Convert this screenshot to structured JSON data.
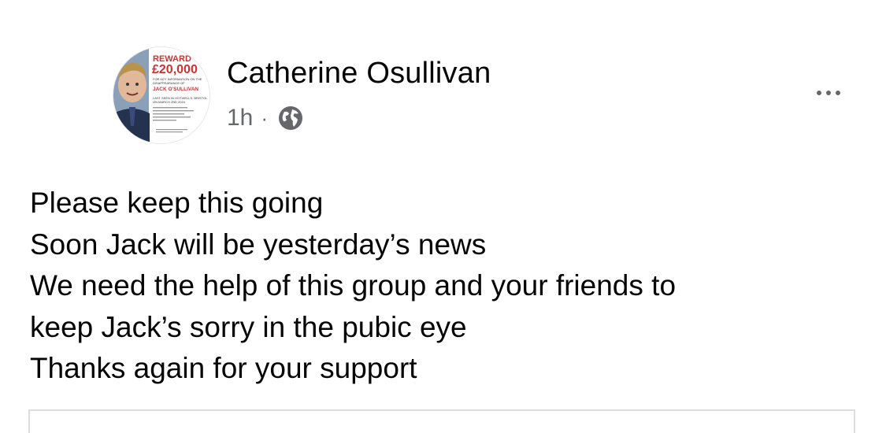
{
  "post": {
    "author": "Catherine Osullivan",
    "time": "1h",
    "separator": "·",
    "audience_icon": "globe-icon",
    "more_icon": "more-horizontal-icon",
    "lines": [
      "Please keep this going",
      "Soon Jack will be yesterday’s news",
      "We need the help of this group and your friends to",
      "keep Jack’s sorry in the pubic eye",
      "Thanks again for your support"
    ]
  },
  "avatar": {
    "reward_label": "REWARD",
    "reward_amount": "£20,000",
    "line1": "FOR KEY INFORMATION ON THE",
    "line2": "DISAPPEARANCE OF",
    "name": "JACK O'SULLIVAN",
    "last_seen": "LAST SEEN IN HOTWELLS, BRISTOL",
    "date": "ON MARCH 2ND 2024"
  },
  "colors": {
    "text": "#050505",
    "secondary": "#65676b",
    "reward_red": "#d32f2f",
    "border": "#dadde1"
  }
}
